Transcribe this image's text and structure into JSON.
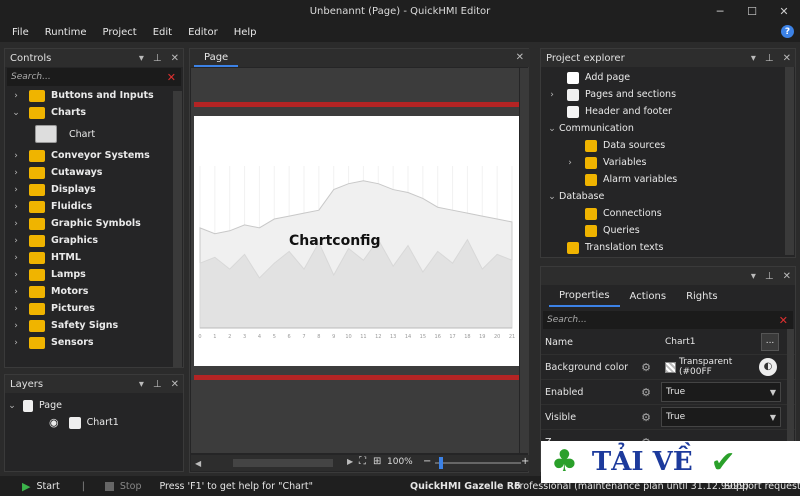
{
  "window": {
    "title": "Unbenannt (Page) - QuickHMI Editor",
    "minimize": "─",
    "maximize": "☐",
    "close": "✕"
  },
  "menu": [
    "File",
    "Runtime",
    "Project",
    "Edit",
    "Editor",
    "Help"
  ],
  "help_icon": "?",
  "controls": {
    "title": "Controls",
    "search_placeholder": "Search...",
    "items": [
      {
        "label": "Buttons and Inputs",
        "expanded": false,
        "color": "#f0b400"
      },
      {
        "label": "Charts",
        "expanded": true,
        "color": "#f0b400"
      },
      {
        "label": "Chart",
        "child": true,
        "color": "#dddddd"
      },
      {
        "label": "Conveyor Systems",
        "expanded": false,
        "color": "#f0b400"
      },
      {
        "label": "Cutaways",
        "expanded": false,
        "color": "#f0b400"
      },
      {
        "label": "Displays",
        "expanded": false,
        "color": "#f0b400"
      },
      {
        "label": "Fluidics",
        "expanded": false,
        "color": "#f0b400"
      },
      {
        "label": "Graphic Symbols",
        "expanded": false,
        "color": "#f0b400"
      },
      {
        "label": "Graphics",
        "expanded": false,
        "color": "#f0b400"
      },
      {
        "label": "HTML",
        "expanded": false,
        "color": "#f0b400"
      },
      {
        "label": "Lamps",
        "expanded": false,
        "color": "#f0b400"
      },
      {
        "label": "Motors",
        "expanded": false,
        "color": "#f0b400"
      },
      {
        "label": "Pictures",
        "expanded": false,
        "color": "#f0b400"
      },
      {
        "label": "Safety Signs",
        "expanded": false,
        "color": "#f0b400"
      },
      {
        "label": "Sensors",
        "expanded": false,
        "color": "#f0b400"
      }
    ]
  },
  "layers": {
    "title": "Layers",
    "items": [
      {
        "label": "Page"
      },
      {
        "label": "Chart1"
      }
    ]
  },
  "document": {
    "tab": "Page",
    "chart_title": "Chartconfig",
    "zoom": "100%"
  },
  "chart_data": {
    "type": "area",
    "title": "Chartconfig",
    "x": [
      0,
      1,
      2,
      3,
      4,
      5,
      6,
      7,
      8,
      9,
      10,
      11,
      12,
      13,
      14,
      15,
      16,
      17,
      18,
      19,
      20,
      21
    ],
    "xlabel": "",
    "ylabel": "",
    "series": [
      {
        "values": [
          68,
          64,
          66,
          70,
          68,
          74,
          76,
          78,
          80,
          94,
          98,
          100,
          98,
          94,
          92,
          88,
          82,
          80,
          78,
          76,
          74,
          72
        ]
      },
      {
        "values": [
          44,
          48,
          40,
          50,
          34,
          44,
          52,
          40,
          58,
          36,
          54,
          46,
          60,
          42,
          56,
          38,
          52,
          44,
          60,
          40,
          50,
          46
        ]
      }
    ]
  },
  "explorer": {
    "title": "Project explorer",
    "items": [
      {
        "label": "Add page",
        "indent": 1,
        "arrow": "",
        "icon": "plus"
      },
      {
        "label": "Pages and sections",
        "indent": 1,
        "arrow": "›",
        "icon": "page"
      },
      {
        "label": "Header and footer",
        "indent": 1,
        "arrow": "",
        "icon": "hf"
      },
      {
        "label": "Communication",
        "indent": 0,
        "arrow": "⌄",
        "icon": ""
      },
      {
        "label": "Data sources",
        "indent": 2,
        "arrow": "",
        "icon": "ds"
      },
      {
        "label": "Variables",
        "indent": 2,
        "arrow": "›",
        "icon": "var"
      },
      {
        "label": "Alarm variables",
        "indent": 2,
        "arrow": "",
        "icon": "alarm"
      },
      {
        "label": "Database",
        "indent": 0,
        "arrow": "⌄",
        "icon": ""
      },
      {
        "label": "Connections",
        "indent": 2,
        "arrow": "",
        "icon": "db"
      },
      {
        "label": "Queries",
        "indent": 2,
        "arrow": "",
        "icon": "db"
      },
      {
        "label": "Translation texts",
        "indent": 1,
        "arrow": "",
        "icon": "tr"
      }
    ]
  },
  "properties": {
    "tabs": [
      "Properties",
      "Actions",
      "Rights"
    ],
    "search_placeholder": "Search...",
    "rows": [
      {
        "label": "Name",
        "value": "Chart1",
        "button": "..."
      },
      {
        "label": "Background color",
        "value": "Transparent (#00FF"
      },
      {
        "label": "Enabled",
        "value": "True"
      },
      {
        "label": "Visible",
        "value": "True"
      },
      {
        "label": "Z",
        "value": ""
      }
    ]
  },
  "status": {
    "start": "Start",
    "stop": "Stop",
    "help": "Press 'F1' to get help for \"Chart\"",
    "product": "QuickHMI Gazelle R6",
    "license": "Professional (maintenance plan until 31.12.9999)",
    "support": "Support request"
  },
  "watermark": {
    "text": "TẢI VỀ"
  }
}
